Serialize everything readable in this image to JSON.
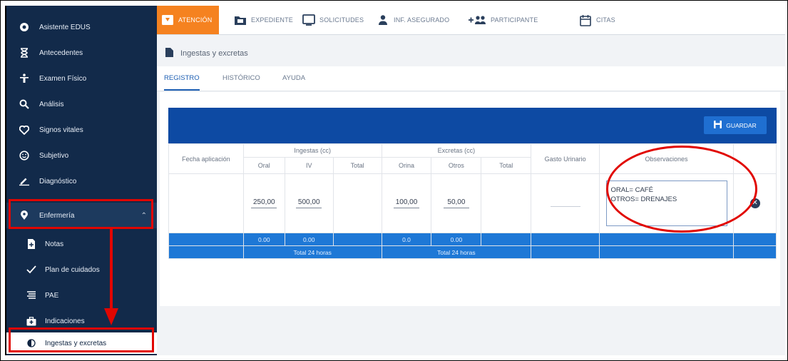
{
  "sidebar": {
    "items": [
      {
        "label": "Asistente EDUS",
        "icon": "brain-icon"
      },
      {
        "label": "Antecedentes",
        "icon": "hourglass-icon"
      },
      {
        "label": "Examen Físico",
        "icon": "person-icon"
      },
      {
        "label": "Análisis",
        "icon": "magnify-icon"
      },
      {
        "label": "Signos vitales",
        "icon": "heart-icon"
      },
      {
        "label": "Subjetivo",
        "icon": "smiley-icon"
      },
      {
        "label": "Diagnóstico",
        "icon": "pencil-icon"
      },
      {
        "label": "Enfermería",
        "icon": "pin-icon"
      },
      {
        "label": "Notas",
        "icon": "file-icon"
      },
      {
        "label": "Plan de cuidados",
        "icon": "check-icon"
      },
      {
        "label": "PAE",
        "icon": "list-icon"
      },
      {
        "label": "Indicaciones",
        "icon": "medkit-icon"
      },
      {
        "label": "Ingestas y excretas",
        "icon": "drop-icon"
      }
    ]
  },
  "topnav": {
    "tabs": [
      {
        "label": "ATENCIÓN",
        "icon": "atencion-icon"
      },
      {
        "label": "EXPEDIENTE",
        "icon": "folder-icon"
      },
      {
        "label": "SOLICITUDES",
        "icon": "window-icon"
      },
      {
        "label": "INF. ASEGURADO",
        "icon": "user-icon"
      },
      {
        "label": "PARTICIPANTE",
        "icon": "add-people-icon"
      },
      {
        "label": "CITAS",
        "icon": "calendar-icon"
      }
    ]
  },
  "panel": {
    "title": "Ingestas y excretas",
    "subtabs": [
      "REGISTRO",
      "HISTÓRICO",
      "AYUDA"
    ],
    "save_label": "GUARDAR"
  },
  "table": {
    "headers": {
      "fecha": "Fecha aplicación",
      "ingestas": "Ingestas (cc)",
      "excretas": "Excretas (cc)",
      "gasto": "Gasto Urinario",
      "observaciones": "Observaciones",
      "oral": "Oral",
      "iv": "IV",
      "total_in": "Total",
      "orina": "Orina",
      "otros": "Otros",
      "total_ex": "Total"
    },
    "row": {
      "oral": "250,00",
      "iv": "500,00",
      "orina": "100,00",
      "otros": "50,00",
      "observaciones": "ORAL= CAFÉ\nOTROS= DRENAJES"
    },
    "totals": {
      "oral": "0.00",
      "iv": "0.00",
      "orina": "0.0",
      "otros": "0.00",
      "ingestas_label": "Total 24 horas",
      "excretas_label": "Total 24 horas"
    }
  },
  "colors": {
    "sidebar_bg": "#122a4a",
    "accent_orange": "#f58220",
    "header_blue": "#0d4aa3",
    "total_row_blue": "#1e78d6",
    "highlight_red": "#e10600"
  }
}
